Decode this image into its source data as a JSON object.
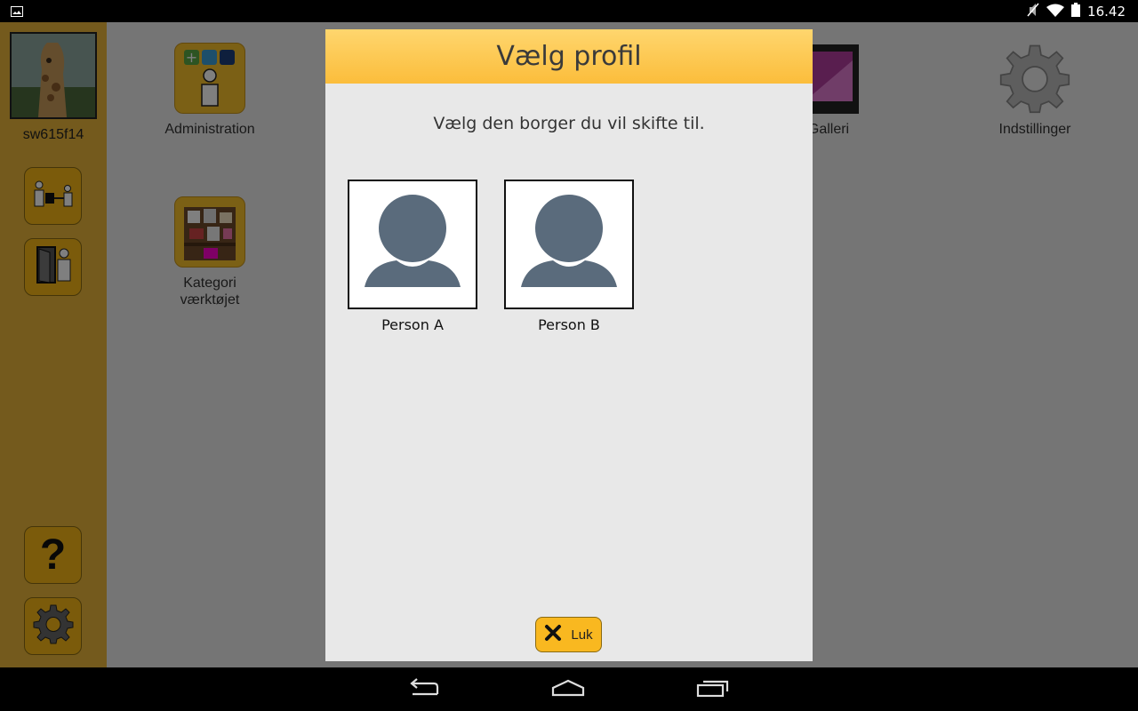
{
  "status_bar": {
    "time": "16.42"
  },
  "sidebar": {
    "profile_name": "sw615f14"
  },
  "apps": [
    {
      "label": "Administration"
    },
    {
      "label": "Kategori\nværktøjet"
    },
    {
      "label": "Galleri"
    },
    {
      "label": "Indstillinger"
    }
  ],
  "dialog": {
    "title": "Vælg profil",
    "subtitle": "Vælg den borger du vil skifte til.",
    "persons": [
      {
        "name": "Person A"
      },
      {
        "name": "Person B"
      }
    ],
    "close_label": "Luk"
  },
  "colors": {
    "sidebar": "#e8b53a",
    "accent": "#f9b820",
    "header_gradient_top": "#ffd66e",
    "header_gradient_bottom": "#fbbd3b",
    "avatar": "#5a6b7c"
  }
}
